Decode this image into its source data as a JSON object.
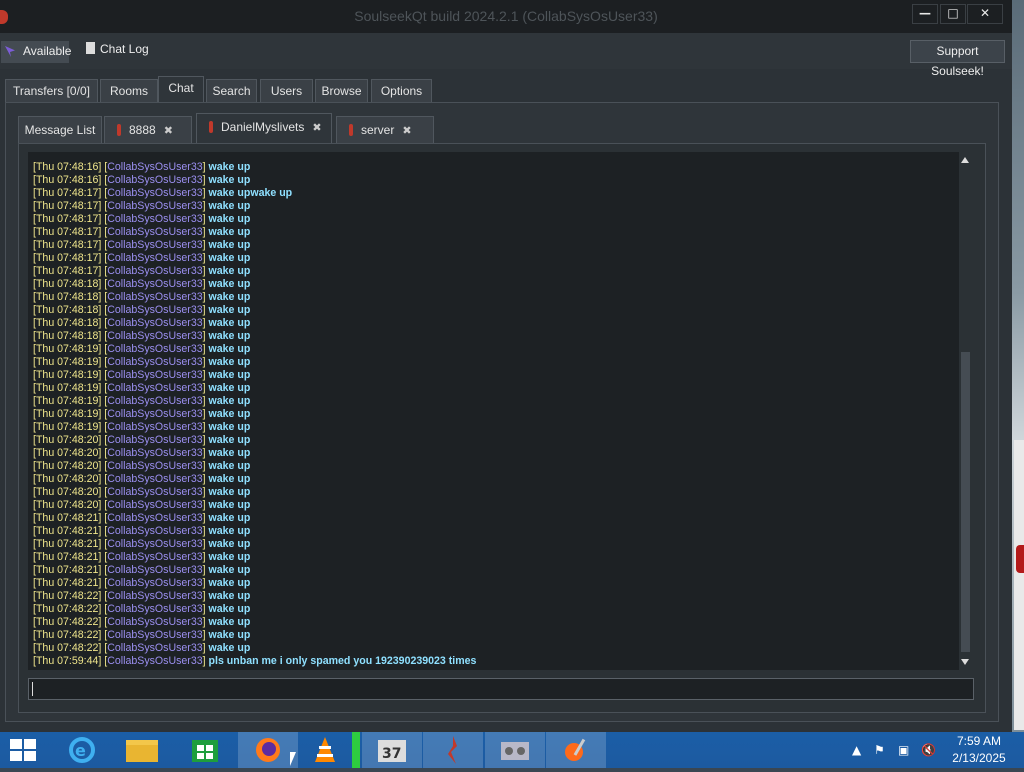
{
  "window": {
    "title": "SoulseekQt build 2024.2.1 (CollabSysOsUser33)",
    "minimize_label": "—",
    "maximize_label": "□",
    "close_label": "✕"
  },
  "toolbar": {
    "status_label": "Available",
    "chatlog_label": "Chat Log",
    "support_label": "Support Soulseek!"
  },
  "main_tabs": [
    {
      "label": "Transfers [0/0]"
    },
    {
      "label": "Rooms"
    },
    {
      "label": "Chat"
    },
    {
      "label": "Search"
    },
    {
      "label": "Users"
    },
    {
      "label": "Browse"
    },
    {
      "label": "Options"
    }
  ],
  "chat_tabs": [
    {
      "label": "Message List"
    },
    {
      "label": "8888"
    },
    {
      "label": "DanielMyslivets"
    },
    {
      "label": "server"
    }
  ],
  "chat": {
    "user": "CollabSysOsUser33",
    "messages": [
      {
        "time": "Thu 07:48:16",
        "text": "wake up"
      },
      {
        "time": "Thu 07:48:16",
        "text": "wake up"
      },
      {
        "time": "Thu 07:48:17",
        "text": "wake upwake up"
      },
      {
        "time": "Thu 07:48:17",
        "text": "wake up"
      },
      {
        "time": "Thu 07:48:17",
        "text": "wake up"
      },
      {
        "time": "Thu 07:48:17",
        "text": "wake up"
      },
      {
        "time": "Thu 07:48:17",
        "text": "wake up"
      },
      {
        "time": "Thu 07:48:17",
        "text": "wake up"
      },
      {
        "time": "Thu 07:48:17",
        "text": "wake up"
      },
      {
        "time": "Thu 07:48:18",
        "text": "wake up"
      },
      {
        "time": "Thu 07:48:18",
        "text": "wake up"
      },
      {
        "time": "Thu 07:48:18",
        "text": "wake up"
      },
      {
        "time": "Thu 07:48:18",
        "text": "wake up"
      },
      {
        "time": "Thu 07:48:18",
        "text": "wake up"
      },
      {
        "time": "Thu 07:48:19",
        "text": "wake up"
      },
      {
        "time": "Thu 07:48:19",
        "text": "wake up"
      },
      {
        "time": "Thu 07:48:19",
        "text": "wake up"
      },
      {
        "time": "Thu 07:48:19",
        "text": "wake up"
      },
      {
        "time": "Thu 07:48:19",
        "text": "wake up"
      },
      {
        "time": "Thu 07:48:19",
        "text": "wake up"
      },
      {
        "time": "Thu 07:48:19",
        "text": "wake up"
      },
      {
        "time": "Thu 07:48:20",
        "text": "wake up"
      },
      {
        "time": "Thu 07:48:20",
        "text": "wake up"
      },
      {
        "time": "Thu 07:48:20",
        "text": "wake up"
      },
      {
        "time": "Thu 07:48:20",
        "text": "wake up"
      },
      {
        "time": "Thu 07:48:20",
        "text": "wake up"
      },
      {
        "time": "Thu 07:48:20",
        "text": "wake up"
      },
      {
        "time": "Thu 07:48:21",
        "text": "wake up"
      },
      {
        "time": "Thu 07:48:21",
        "text": "wake up"
      },
      {
        "time": "Thu 07:48:21",
        "text": "wake up"
      },
      {
        "time": "Thu 07:48:21",
        "text": "wake up"
      },
      {
        "time": "Thu 07:48:21",
        "text": "wake up"
      },
      {
        "time": "Thu 07:48:21",
        "text": "wake up"
      },
      {
        "time": "Thu 07:48:22",
        "text": "wake up"
      },
      {
        "time": "Thu 07:48:22",
        "text": "wake up"
      },
      {
        "time": "Thu 07:48:22",
        "text": "wake up"
      },
      {
        "time": "Thu 07:48:22",
        "text": "wake up"
      },
      {
        "time": "Thu 07:48:22",
        "text": "wake up"
      },
      {
        "time": "Thu 07:59:44",
        "text": "pls unban me i only spamed you 192390239023 times"
      }
    ]
  },
  "input": {
    "value": ""
  },
  "taskbar": {
    "apps": [
      "start-button",
      "internet-explorer",
      "file-explorer",
      "store",
      "firefox",
      "vlc",
      "media-app",
      "calendar-app",
      "soulseek",
      "game-app",
      "paint-app"
    ],
    "time": "7:59 AM",
    "date": "2/13/2025"
  },
  "colors": {
    "timestamp": "#f0e68c",
    "username": "#9b8ff0",
    "message": "#8fe0ff",
    "taskbar": "#1c5aa0"
  }
}
